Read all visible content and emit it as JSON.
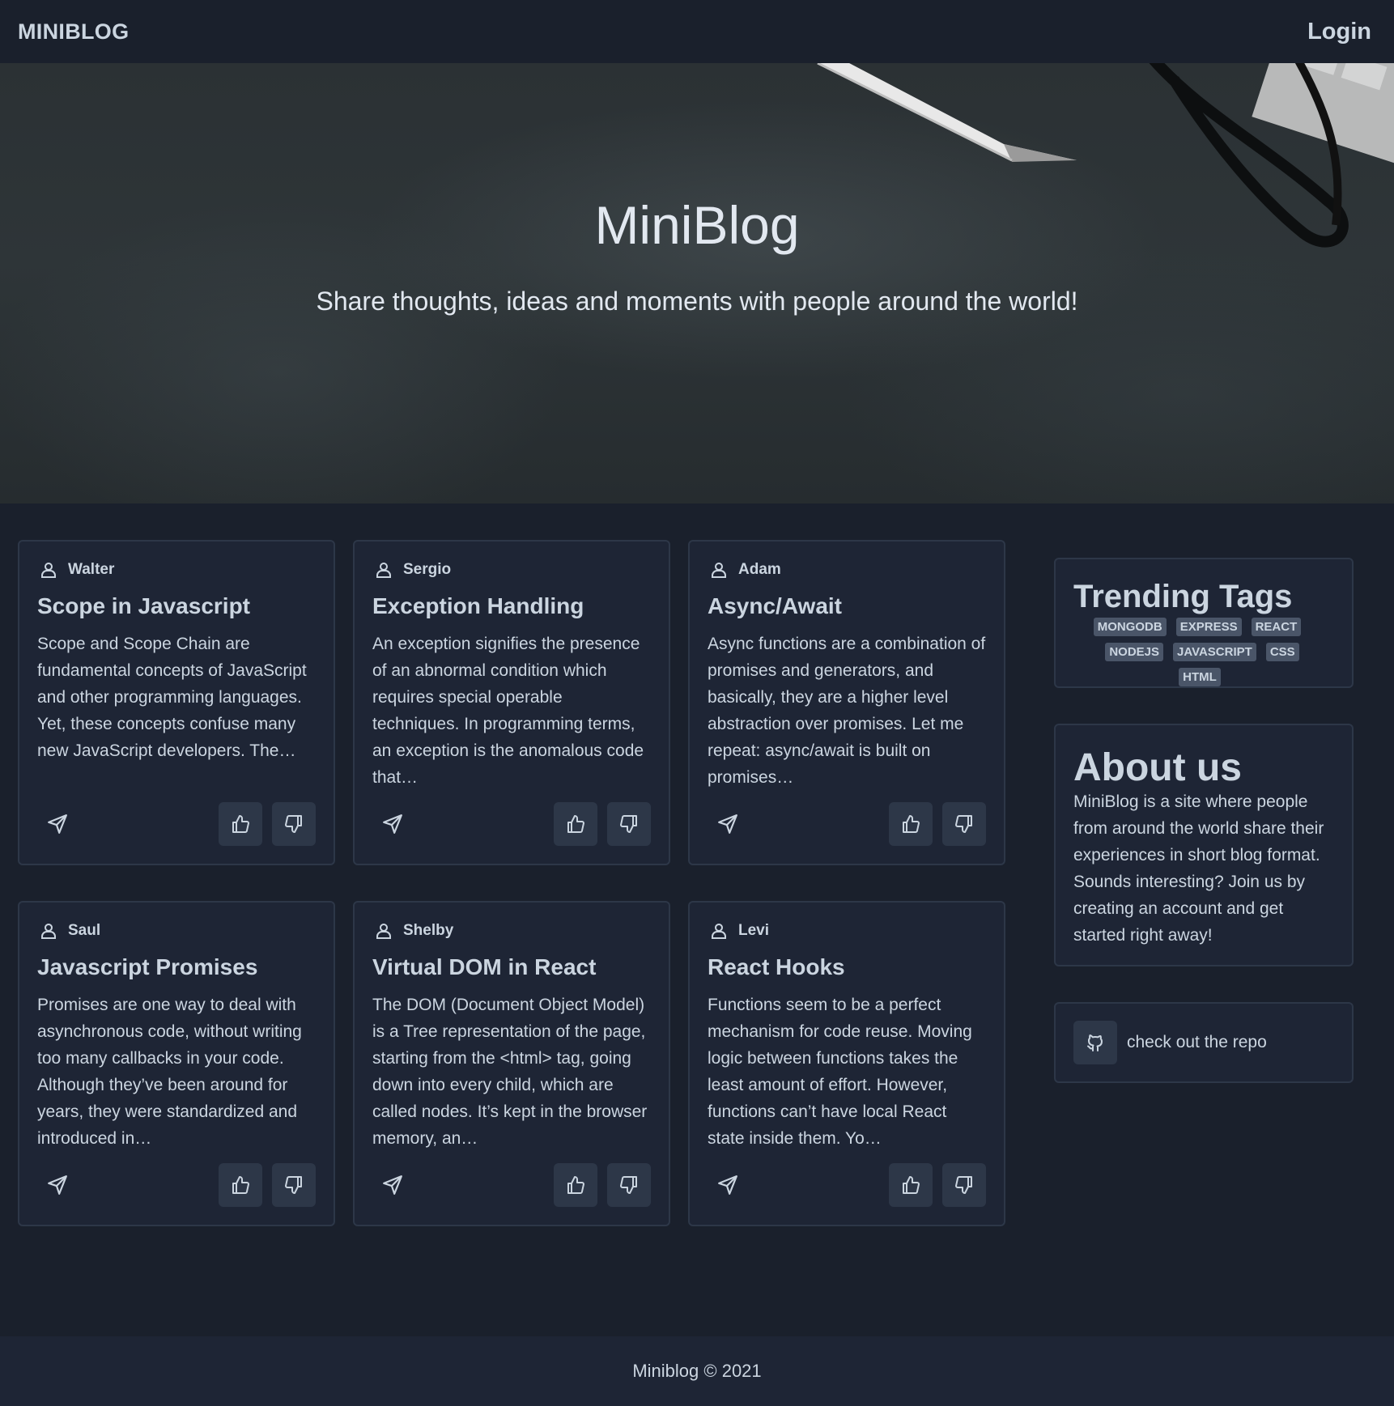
{
  "navbar": {
    "brand": "MINIBLOG",
    "login_label": "Login"
  },
  "hero": {
    "title": "MiniBlog",
    "subtitle": "Share thoughts, ideas and moments with people around the world!"
  },
  "posts": [
    {
      "author": "Walter",
      "title": "Scope in Javascript",
      "body": "Scope and Scope Chain are fundamental concepts of JavaScript and other programming languages. Yet, these concepts confuse many new JavaScript developers. The…"
    },
    {
      "author": "Sergio",
      "title": "Exception Handling",
      "body": "An exception signifies the presence of an abnormal condition which requires special operable techniques. In programming terms, an exception is the anomalous code that…"
    },
    {
      "author": "Adam",
      "title": "Async/Await",
      "body": "Async functions are a combination of promises and generators, and basically, they are a higher level abstraction over promises. Let me repeat: async/await is built on promises…"
    },
    {
      "author": "Saul",
      "title": "Javascript Promises",
      "body": "Promises are one way to deal with asynchronous code, without writing too many callbacks in your code. Although they’ve been around for years, they were standardized and introduced in…"
    },
    {
      "author": "Shelby",
      "title": "Virtual DOM in React",
      "body": "The DOM (Document Object Model) is a Tree representation of the page, starting from the <html> tag, going down into every child, which are called nodes. It’s kept in the browser memory, an…"
    },
    {
      "author": "Levi",
      "title": "React Hooks",
      "body": "Functions seem to be a perfect mechanism for code reuse. Moving logic between functions takes the least amount of effort. However, functions can’t have local React state inside them. Yo…"
    }
  ],
  "sidebar": {
    "tags_title": "Trending Tags",
    "tags": [
      "MONGODB",
      "EXPRESS",
      "REACT",
      "NODEJS",
      "JAVASCRIPT",
      "CSS",
      "HTML"
    ],
    "about_title": "About us",
    "about_text": "MiniBlog is a site where people from around the world share their experiences in short blog format. Sounds interesting? Join us by creating an account and get started right away!",
    "repo_label": "check out the repo"
  },
  "footer": {
    "text": "Miniblog © 2021"
  },
  "icons": {
    "author": "user-icon",
    "share": "send-icon",
    "upvote": "thumbs-up-icon",
    "downvote": "thumbs-down-icon",
    "repo": "github-icon"
  },
  "colors": {
    "background": "#1a202c",
    "card": "#1e2535",
    "button": "#2d3748",
    "tag": "#4a5568",
    "text": "#cbd5e0"
  }
}
